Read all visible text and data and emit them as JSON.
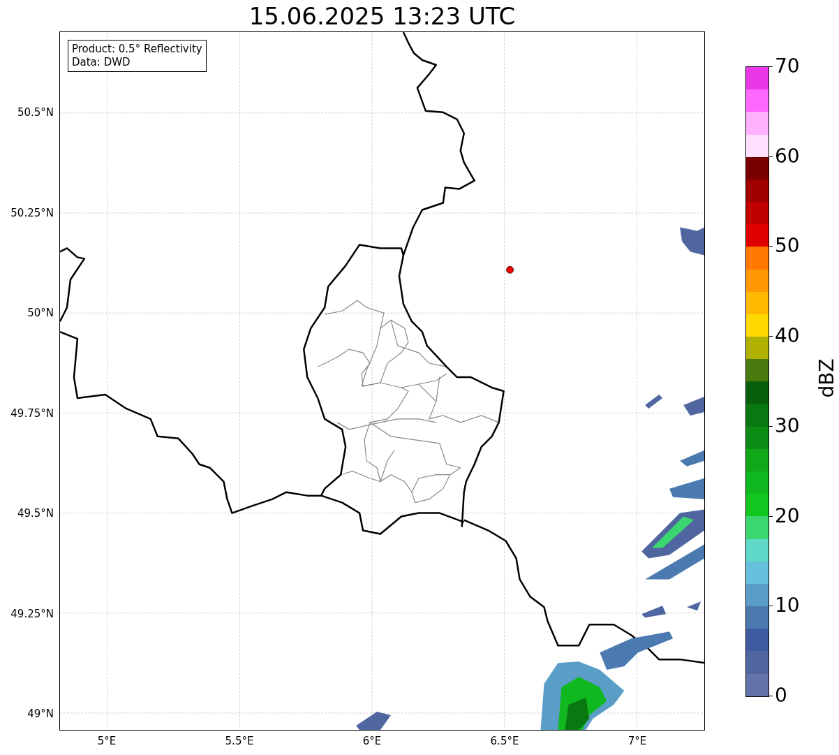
{
  "title": "15.06.2025 13:23 UTC",
  "legend": [
    "Product: 0.5° Reflectivity",
    "Data: DWD"
  ],
  "x_ticks": [
    "5°E",
    "5.5°E",
    "6°E",
    "6.5°E",
    "7°E"
  ],
  "y_ticks": [
    "50.5°N",
    "50.25°N",
    "50°N",
    "49.75°N",
    "49.5°N",
    "49.25°N",
    "49°N"
  ],
  "colorbar": {
    "label": "dBZ",
    "ticks": [
      "70",
      "60",
      "50",
      "40",
      "30",
      "20",
      "10",
      "0"
    ],
    "segments": [
      {
        "color": "#6474a8"
      },
      {
        "color": "#5066a0"
      },
      {
        "color": "#405ca0"
      },
      {
        "color": "#4a7ab0"
      },
      {
        "color": "#5a9ec8"
      },
      {
        "color": "#66c0dc"
      },
      {
        "color": "#60d8c8"
      },
      {
        "color": "#3cd670"
      },
      {
        "color": "#10c820"
      },
      {
        "color": "#10b820"
      },
      {
        "color": "#10a818"
      },
      {
        "color": "#0c8c14"
      },
      {
        "color": "#0a7810"
      },
      {
        "color": "#08600c"
      },
      {
        "color": "#487a10"
      },
      {
        "color": "#b0b000"
      },
      {
        "color": "#ffd800"
      },
      {
        "color": "#ffb800"
      },
      {
        "color": "#ff9800"
      },
      {
        "color": "#ff7800"
      },
      {
        "color": "#e00000"
      },
      {
        "color": "#c00000"
      },
      {
        "color": "#a00000"
      },
      {
        "color": "#780000"
      },
      {
        "color": "#ffe0ff"
      },
      {
        "color": "#ffb0ff"
      },
      {
        "color": "#ff68ff"
      },
      {
        "color": "#e838e8"
      }
    ]
  }
}
